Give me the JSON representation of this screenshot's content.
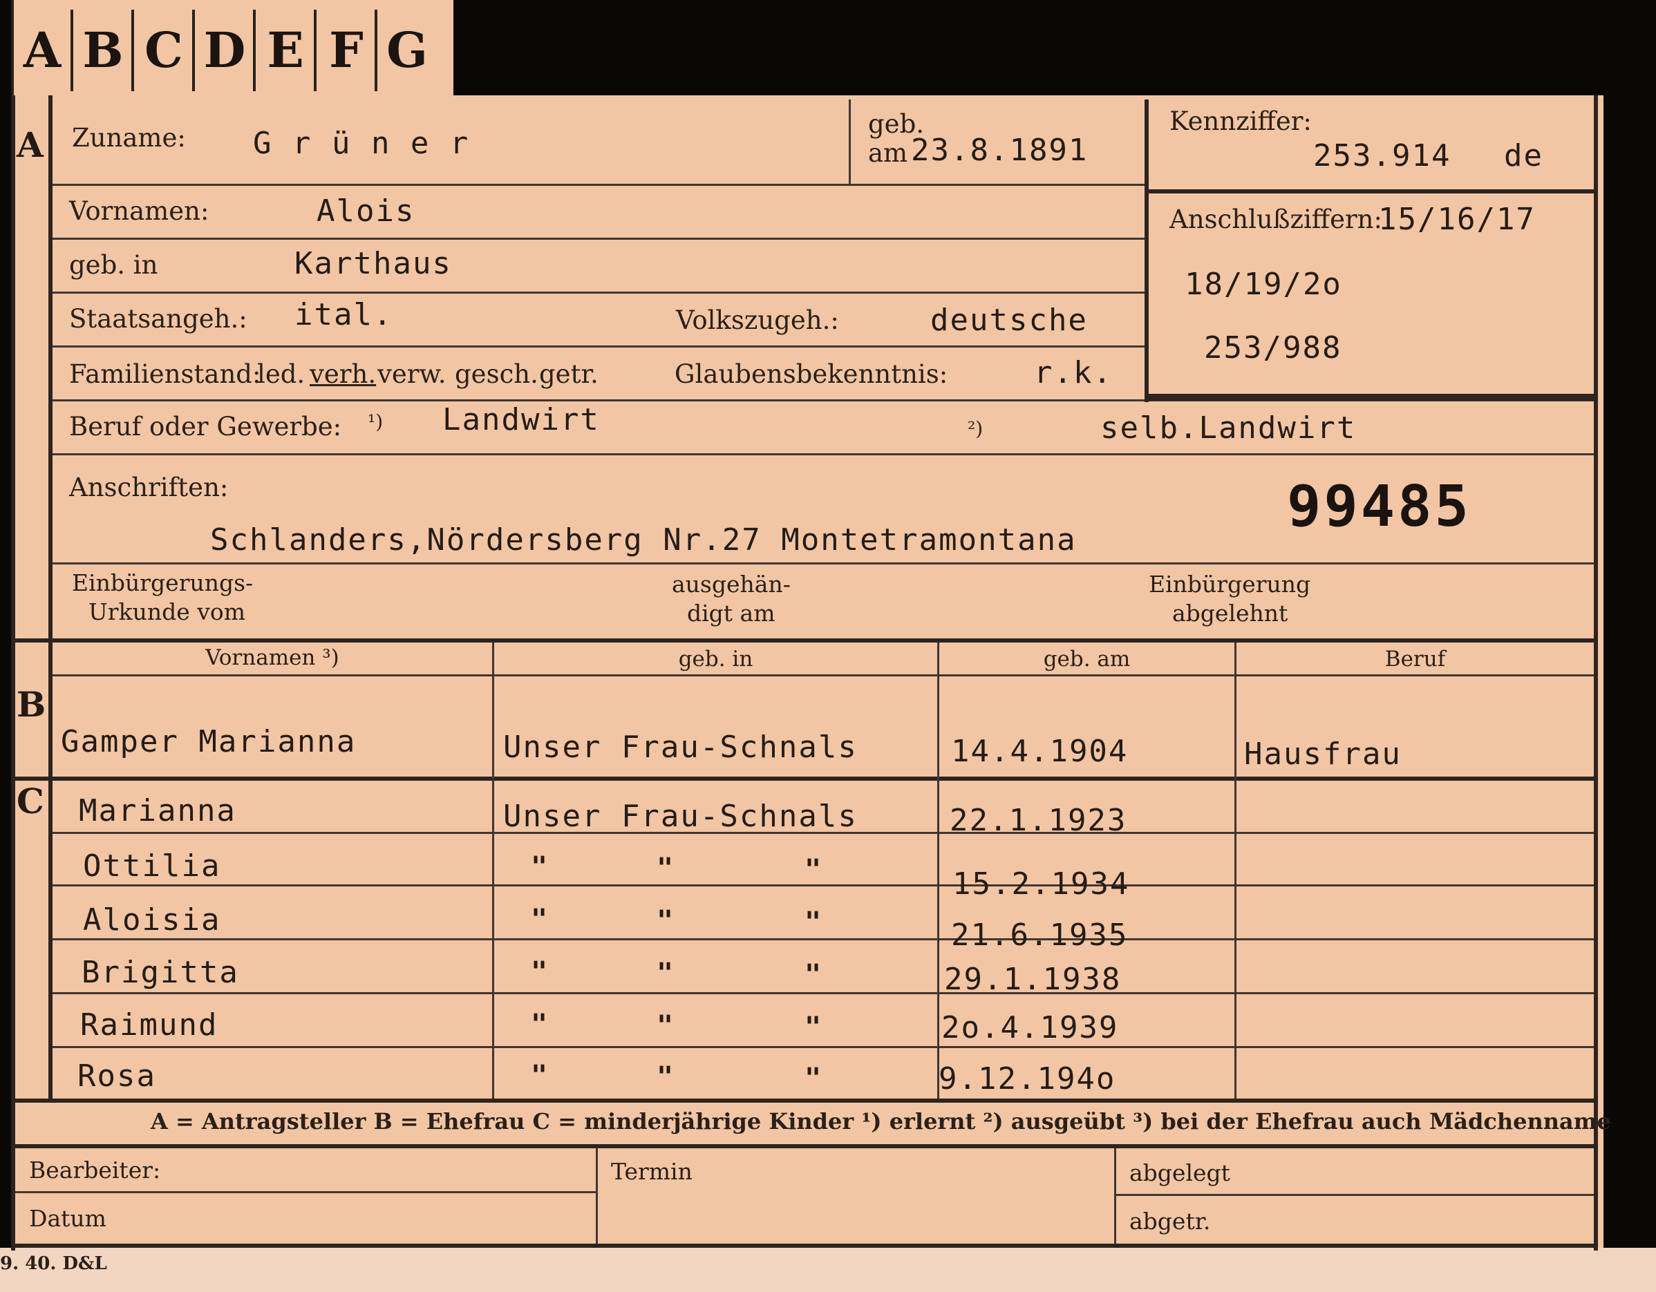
{
  "tabs": [
    "A",
    "B",
    "C",
    "D",
    "E",
    "F",
    "G"
  ],
  "applicant": {
    "section_mark": "A",
    "surname_label": "Zuname:",
    "surname": "G r ü n e r",
    "born_label_1": "geb.",
    "born_label_2": "am",
    "born_date": "23.8.1891",
    "ref_label": "Kennziffer:",
    "ref_number": "253.914",
    "ref_suffix": "de",
    "linked_label": "Anschlußziffern:",
    "linked_1": "15/16/17",
    "linked_2": "18/19/2o",
    "linked_3": "253/988",
    "firstname_label": "Vornamen:",
    "firstname": "Alois",
    "birthplace_label": "geb. in",
    "birthplace": "Karthaus",
    "citizenship_label": "Staatsangeh.:",
    "citizenship": "ital.",
    "ethnicity_label": "Volkszugeh.:",
    "ethnicity": "deutsche",
    "marital_label": "Familienstand:",
    "marital_opt_1": "led.",
    "marital_opt_2": "verh.",
    "marital_opt_3": "verw.",
    "marital_opt_4": "gesch.",
    "marital_opt_5": "getr.",
    "religion_label": "Glaubensbekenntnis:",
    "religion": "r.k.",
    "occupation_label": "Beruf oder Gewerbe:",
    "occupation_note_1": "¹)",
    "occupation_1": "Landwirt",
    "occupation_note_2": "²)",
    "occupation_2": "selb.Landwirt",
    "address_label": "Anschriften:",
    "address": "Schlanders,Nördersberg Nr.27 Montetramontana",
    "stamp_number": "99485",
    "naturalization_label_1": "Einbürgerungs-",
    "naturalization_label_2": "Urkunde vom",
    "handed_label_1": "ausgehän-",
    "handed_label_2": "digt am",
    "refused_label_1": "Einbürgerung",
    "refused_label_2": "abgelehnt"
  },
  "table": {
    "headers": [
      "Vornamen ³)",
      "geb. in",
      "geb. am",
      "Beruf"
    ],
    "spouse_mark": "B",
    "spouse": {
      "name": "Gamper Marianna",
      "birthplace": "Unser Frau-Schnals",
      "born": "14.4.1904",
      "occupation": "Hausfrau"
    },
    "children_mark": "C",
    "ditto": "\"",
    "children": [
      {
        "name": "Marianna",
        "birthplace": "Unser Frau-Schnals",
        "born": "22.1.1923"
      },
      {
        "name": "Ottilia",
        "born": "15.2.1934"
      },
      {
        "name": "Aloisia",
        "born": "21.6.1935"
      },
      {
        "name": "Brigitta",
        "born": "29.1.1938"
      },
      {
        "name": "Raimund",
        "born": "2o.4.1939"
      },
      {
        "name": "Rosa",
        "born": "9.12.194o"
      }
    ]
  },
  "legend": "A = Antragsteller   B = Ehefrau   C = minderjährige Kinder   ¹) erlernt   ²) ausgeübt   ³) bei der Ehefrau auch Mädchenname",
  "footer": {
    "clerk_label": "Bearbeiter:",
    "date_label": "Datum",
    "deadline_label": "Termin",
    "filed_label": "abgelegt",
    "sent_label": "abgetr."
  },
  "imprint": "9. 40. D&L"
}
